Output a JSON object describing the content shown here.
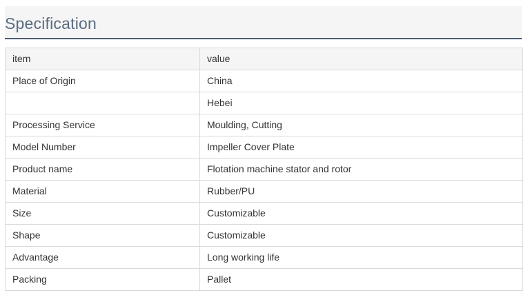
{
  "section": {
    "title": "Specification"
  },
  "table": {
    "rows": [
      {
        "item": "item",
        "value": "value"
      },
      {
        "item": "Place of Origin",
        "value": "China"
      },
      {
        "item": "",
        "value": "Hebei"
      },
      {
        "item": "Processing Service",
        "value": "Moulding, Cutting"
      },
      {
        "item": "Model Number",
        "value": "Impeller Cover Plate"
      },
      {
        "item": "Product name",
        "value": "Flotation machine stator and rotor"
      },
      {
        "item": "Material",
        "value": "Rubber/PU"
      },
      {
        "item": "Size",
        "value": "Customizable"
      },
      {
        "item": "Shape",
        "value": "Customizable"
      },
      {
        "item": "Advantage",
        "value": "Long working life"
      },
      {
        "item": "Packing",
        "value": "Pallet"
      }
    ]
  }
}
